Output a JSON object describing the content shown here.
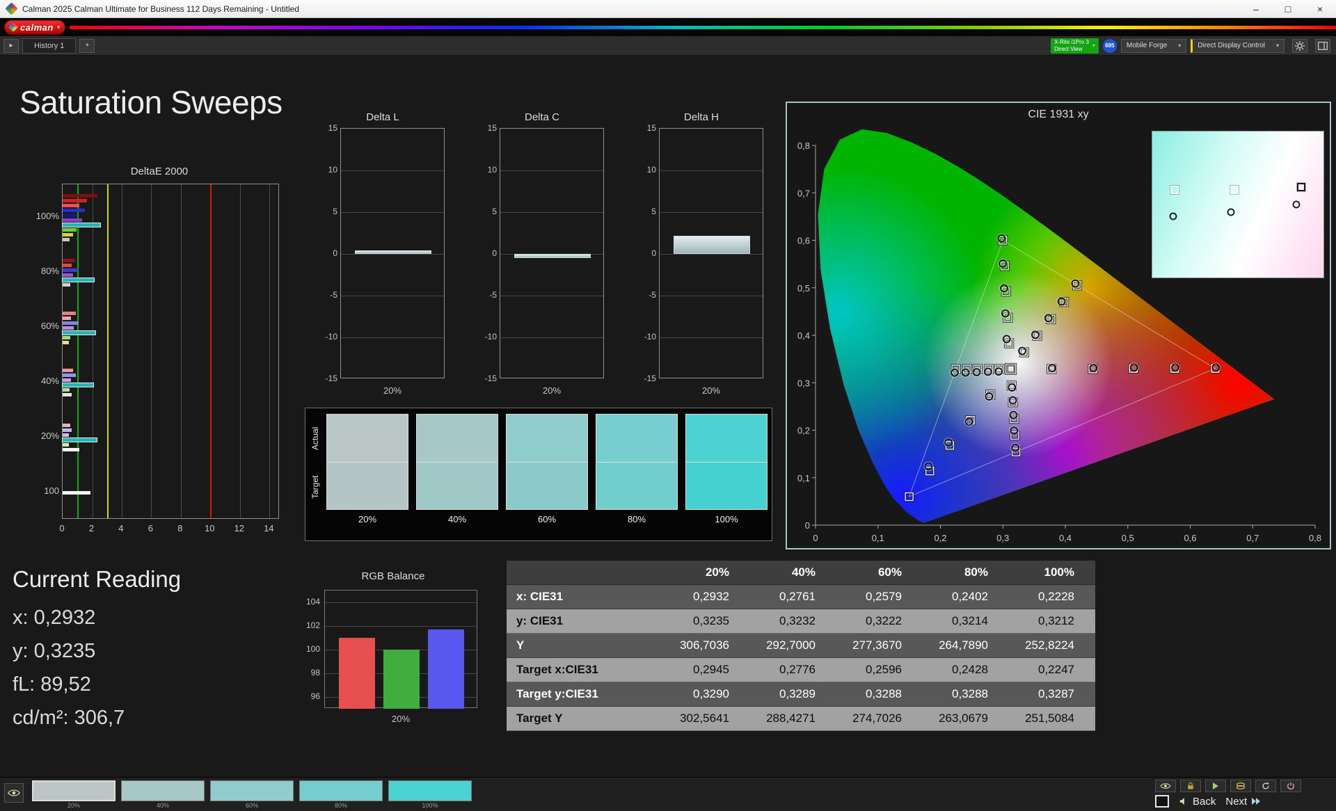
{
  "window": {
    "title": "Calman 2025 Calman Ultimate for Business 112 Days Remaining  - Untitled",
    "minimize": "–",
    "maximize": "□",
    "close": "×"
  },
  "brand": {
    "logo_text": "calman"
  },
  "icons": {
    "chevron_down": "▾",
    "history_expand": "▸",
    "add_tab": "+"
  },
  "toolbar": {
    "history_tab": "History 1",
    "meter": {
      "line1": "X-Rite i1Pro 3",
      "line2": "Direct View",
      "color": "#13a513"
    },
    "badge": {
      "text": "695",
      "color": "#1f55d4"
    },
    "source": "Mobile Forge",
    "display_control": "Direct Display Control",
    "accent_yellow": "#e6d800"
  },
  "page_title": "Saturation Sweeps",
  "current_reading": {
    "title": "Current Reading",
    "lines": [
      "x: 0,2932",
      "y: 0,3235",
      "fL: 89,52",
      "cd/m²: 306,7"
    ]
  },
  "swatch_strip": {
    "row_labels": [
      "Actual",
      "Target"
    ],
    "levels": [
      {
        "label": "20%",
        "actual": "#b9c6c5",
        "target": "#b3c5c4"
      },
      {
        "label": "40%",
        "actual": "#a6c9c8",
        "target": "#a0c8c7"
      },
      {
        "label": "60%",
        "actual": "#90cccb",
        "target": "#8acbca"
      },
      {
        "label": "80%",
        "actual": "#76cfce",
        "target": "#70cecd"
      },
      {
        "label": "100%",
        "actual": "#4cd2d1",
        "target": "#45d1d0"
      }
    ]
  },
  "bottom_bar": {
    "back": "Back",
    "next": "Next",
    "swatches": [
      {
        "label": "20%",
        "color": "#b9c6c5",
        "selected": true
      },
      {
        "label": "40%",
        "color": "#a6c9c8",
        "selected": false
      },
      {
        "label": "60%",
        "color": "#90cccb",
        "selected": false
      },
      {
        "label": "80%",
        "color": "#76cfce",
        "selected": false
      },
      {
        "label": "100%",
        "color": "#4cd2d1",
        "selected": false
      }
    ]
  },
  "chart_data": [
    {
      "id": "deltae",
      "type": "bar",
      "orientation": "horizontal",
      "title": "DeltaE 2000",
      "xlim": [
        0,
        14.6
      ],
      "xticks": [
        0,
        2,
        4,
        6,
        8,
        10,
        12,
        14
      ],
      "reference_lines": [
        {
          "value": 1,
          "color": "#00b400"
        },
        {
          "value": 3,
          "color": "#d4d400"
        },
        {
          "value": 10,
          "color": "#dc1414"
        }
      ],
      "groups": [
        {
          "label": "100%",
          "bars": [
            {
              "value": 2.35,
              "color": "#7a1010"
            },
            {
              "value": 1.65,
              "color": "#d02020"
            },
            {
              "value": 1.15,
              "color": "#f05050"
            },
            {
              "value": 1.5,
              "color": "#2830c0"
            },
            {
              "value": 0.95,
              "color": "#161a80"
            },
            {
              "value": 1.3,
              "color": "#8a3cc8"
            },
            {
              "value": 2.55,
              "color": "#28b4b4",
              "highlight": true
            },
            {
              "value": 0.95,
              "color": "#78c83c"
            },
            {
              "value": 0.7,
              "color": "#d2d23c"
            },
            {
              "value": 0.45,
              "color": "#c8c8c8"
            }
          ]
        },
        {
          "label": "80%",
          "bars": [
            {
              "value": 0.85,
              "color": "#8a1818"
            },
            {
              "value": 0.6,
              "color": "#e04848"
            },
            {
              "value": 1.05,
              "color": "#3840c8"
            },
            {
              "value": 0.7,
              "color": "#9a50d0"
            },
            {
              "value": 2.1,
              "color": "#28b4b4",
              "highlight": true
            },
            {
              "value": 0.5,
              "color": "#d0d0d0"
            }
          ]
        },
        {
          "label": "60%",
          "bars": [
            {
              "value": 0.9,
              "color": "#e08484"
            },
            {
              "value": 0.55,
              "color": "#f0a8a8"
            },
            {
              "value": 1.1,
              "color": "#8088e0"
            },
            {
              "value": 0.75,
              "color": "#c088e0"
            },
            {
              "value": 2.2,
              "color": "#28b4b4",
              "highlight": true
            },
            {
              "value": 0.5,
              "color": "#a8d488"
            },
            {
              "value": 0.4,
              "color": "#e0e08c"
            }
          ]
        },
        {
          "label": "40%",
          "bars": [
            {
              "value": 0.7,
              "color": "#e89898"
            },
            {
              "value": 0.9,
              "color": "#9098e8"
            },
            {
              "value": 0.55,
              "color": "#d098e8"
            },
            {
              "value": 2.05,
              "color": "#28b4b4",
              "highlight": true
            },
            {
              "value": 0.45,
              "color": "#b8dc9c"
            },
            {
              "value": 0.6,
              "color": "#e4e4e4"
            }
          ]
        },
        {
          "label": "20%",
          "bars": [
            {
              "value": 0.5,
              "color": "#f0b4b4"
            },
            {
              "value": 0.6,
              "color": "#b4bcf0"
            },
            {
              "value": 0.4,
              "color": "#e4b4f0"
            },
            {
              "value": 2.3,
              "color": "#28b4b4",
              "highlight": true
            },
            {
              "value": 0.4,
              "color": "#ccecb4"
            },
            {
              "value": 1.15,
              "color": "#f4f4f4"
            }
          ]
        },
        {
          "label": "100",
          "bars": [
            {
              "value": 1.9,
              "color": "#f4f4f4"
            }
          ]
        }
      ]
    },
    {
      "id": "delta_l",
      "type": "bar",
      "title": "Delta L",
      "categories": [
        "20%"
      ],
      "values": [
        0.4
      ],
      "ylim": [
        -15,
        15
      ],
      "yticks": [
        15,
        10,
        5,
        0,
        -5,
        -10,
        -15
      ]
    },
    {
      "id": "delta_c",
      "type": "bar",
      "title": "Delta C",
      "categories": [
        "20%"
      ],
      "values": [
        -0.5
      ],
      "ylim": [
        -15,
        15
      ],
      "yticks": [
        15,
        10,
        5,
        0,
        -5,
        -10,
        -15
      ]
    },
    {
      "id": "delta_h",
      "type": "bar",
      "title": "Delta H",
      "categories": [
        "20%"
      ],
      "values": [
        2.2
      ],
      "ylim": [
        -15,
        15
      ],
      "yticks": [
        15,
        10,
        5,
        0,
        -5,
        -10,
        -15
      ]
    },
    {
      "id": "rgb_balance",
      "type": "bar",
      "title": "RGB Balance",
      "categories": [
        "Red",
        "Green",
        "Blue"
      ],
      "values": [
        101.0,
        100.0,
        101.7
      ],
      "colors": [
        "#e85050",
        "#3fae3f",
        "#5858f0"
      ],
      "ylim": [
        95,
        105
      ],
      "yticks": [
        104,
        102,
        100,
        98,
        96
      ],
      "xlabel": "20%"
    },
    {
      "id": "cie",
      "type": "scatter",
      "title": "CIE 1931 xy",
      "xlim": [
        0,
        0.8
      ],
      "ylim": [
        0,
        0.8
      ],
      "xtick_labels": [
        "0",
        "0,1",
        "0,2",
        "0,3",
        "0,4",
        "0,5",
        "0,6",
        "0,7",
        "0,8"
      ],
      "ytick_labels": [
        "0",
        "0,1",
        "0,2",
        "0,3",
        "0,4",
        "0,5",
        "0,6",
        "0,7",
        "0,8"
      ],
      "gamut_triangle": [
        [
          0.64,
          0.33
        ],
        [
          0.3,
          0.6
        ],
        [
          0.15,
          0.06
        ]
      ],
      "white_point": [
        0.3127,
        0.329
      ],
      "spectral_locus": [
        [
          0.1741,
          0.005
        ],
        [
          0.166,
          0.009
        ],
        [
          0.1566,
          0.0177
        ],
        [
          0.144,
          0.0297
        ],
        [
          0.1241,
          0.0578
        ],
        [
          0.1096,
          0.0868
        ],
        [
          0.0913,
          0.1327
        ],
        [
          0.0687,
          0.2007
        ],
        [
          0.0454,
          0.295
        ],
        [
          0.0235,
          0.4127
        ],
        [
          0.0082,
          0.5384
        ],
        [
          0.0039,
          0.6548
        ],
        [
          0.0139,
          0.7502
        ],
        [
          0.0389,
          0.812
        ],
        [
          0.0743,
          0.8338
        ],
        [
          0.1142,
          0.8262
        ],
        [
          0.1547,
          0.8059
        ],
        [
          0.1929,
          0.7816
        ],
        [
          0.2296,
          0.7543
        ],
        [
          0.2658,
          0.7243
        ],
        [
          0.3016,
          0.6923
        ],
        [
          0.3373,
          0.6589
        ],
        [
          0.3731,
          0.6245
        ],
        [
          0.4087,
          0.5896
        ],
        [
          0.4441,
          0.5547
        ],
        [
          0.4788,
          0.5202
        ],
        [
          0.5125,
          0.4866
        ],
        [
          0.5448,
          0.4544
        ],
        [
          0.5752,
          0.4242
        ],
        [
          0.6029,
          0.3965
        ],
        [
          0.627,
          0.3725
        ],
        [
          0.6482,
          0.3514
        ],
        [
          0.6658,
          0.334
        ],
        [
          0.6801,
          0.3197
        ],
        [
          0.6915,
          0.3083
        ],
        [
          0.7006,
          0.2993
        ],
        [
          0.714,
          0.2859
        ],
        [
          0.726,
          0.274
        ],
        [
          0.7347,
          0.2653
        ]
      ],
      "targets": [
        [
          0.3127,
          0.329
        ],
        [
          0.378,
          0.329
        ],
        [
          0.444,
          0.329
        ],
        [
          0.509,
          0.33
        ],
        [
          0.575,
          0.33
        ],
        [
          0.64,
          0.33
        ],
        [
          0.31,
          0.383
        ],
        [
          0.308,
          0.437
        ],
        [
          0.305,
          0.492
        ],
        [
          0.303,
          0.546
        ],
        [
          0.3,
          0.6
        ],
        [
          0.28,
          0.275
        ],
        [
          0.248,
          0.221
        ],
        [
          0.215,
          0.168
        ],
        [
          0.183,
          0.114
        ],
        [
          0.15,
          0.06
        ],
        [
          0.314,
          0.294
        ],
        [
          0.316,
          0.259
        ],
        [
          0.318,
          0.224
        ],
        [
          0.319,
          0.189
        ],
        [
          0.321,
          0.154
        ],
        [
          0.334,
          0.364
        ],
        [
          0.355,
          0.399
        ],
        [
          0.377,
          0.434
        ],
        [
          0.398,
          0.47
        ],
        [
          0.419,
          0.505
        ],
        [
          0.2945,
          0.329
        ],
        [
          0.2776,
          0.3289
        ],
        [
          0.2596,
          0.3288
        ],
        [
          0.2428,
          0.3288
        ],
        [
          0.2247,
          0.3287
        ]
      ],
      "measured": [
        [
          0.2932,
          0.3235
        ],
        [
          0.2761,
          0.3232
        ],
        [
          0.2579,
          0.3222
        ],
        [
          0.2402,
          0.3214
        ],
        [
          0.2228,
          0.3212
        ],
        [
          0.306,
          0.392
        ],
        [
          0.304,
          0.446
        ],
        [
          0.302,
          0.499
        ],
        [
          0.3,
          0.551
        ],
        [
          0.298,
          0.604
        ],
        [
          0.331,
          0.367
        ],
        [
          0.352,
          0.401
        ],
        [
          0.373,
          0.436
        ],
        [
          0.394,
          0.471
        ],
        [
          0.416,
          0.509
        ],
        [
          0.3145,
          0.29
        ],
        [
          0.316,
          0.263
        ],
        [
          0.317,
          0.232
        ],
        [
          0.318,
          0.199
        ],
        [
          0.32,
          0.163
        ],
        [
          0.278,
          0.271
        ],
        [
          0.246,
          0.218
        ],
        [
          0.213,
          0.174
        ],
        [
          0.181,
          0.124
        ],
        [
          0.379,
          0.331
        ],
        [
          0.445,
          0.331
        ],
        [
          0.51,
          0.332
        ],
        [
          0.576,
          0.332
        ],
        [
          0.641,
          0.332
        ]
      ],
      "inset": {
        "squares": [
          {
            "x": 0.13,
            "y": 0.4,
            "stroke": "#f8f8f8"
          },
          {
            "x": 0.48,
            "y": 0.4,
            "stroke": "#f8f8f8"
          },
          {
            "x": 0.87,
            "y": 0.38,
            "stroke": "#1a1a1a"
          }
        ],
        "circles": [
          {
            "x": 0.12,
            "y": 0.58
          },
          {
            "x": 0.46,
            "y": 0.55
          },
          {
            "x": 0.84,
            "y": 0.5
          }
        ]
      }
    },
    {
      "id": "sat_table",
      "type": "table",
      "columns": [
        "20%",
        "40%",
        "60%",
        "80%",
        "100%"
      ],
      "rows": [
        {
          "label": "x: CIE31",
          "values": [
            "0,2932",
            "0,2761",
            "0,2579",
            "0,2402",
            "0,2228"
          ]
        },
        {
          "label": "y: CIE31",
          "values": [
            "0,3235",
            "0,3232",
            "0,3222",
            "0,3214",
            "0,3212"
          ]
        },
        {
          "label": "Y",
          "values": [
            "306,7036",
            "292,7000",
            "277,3670",
            "264,7890",
            "252,8224"
          ]
        },
        {
          "label": "Target x:CIE31",
          "values": [
            "0,2945",
            "0,2776",
            "0,2596",
            "0,2428",
            "0,2247"
          ]
        },
        {
          "label": "Target y:CIE31",
          "values": [
            "0,3290",
            "0,3289",
            "0,3288",
            "0,3288",
            "0,3287"
          ]
        },
        {
          "label": "Target Y",
          "values": [
            "302,5641",
            "288,4271",
            "274,7026",
            "263,0679",
            "251,5084"
          ]
        }
      ]
    }
  ]
}
